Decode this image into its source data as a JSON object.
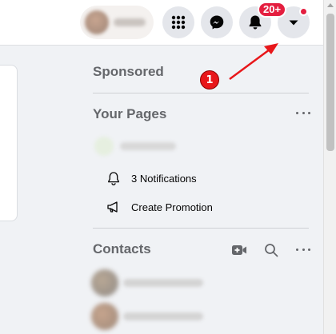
{
  "header": {
    "notification_badge": "20+",
    "icons": [
      "menu-grid-icon",
      "messenger-icon",
      "bell-icon",
      "caret-down-icon"
    ]
  },
  "sidebar": {
    "sponsored_title": "Sponsored",
    "pages": {
      "title": "Your Pages",
      "notifications_label": "3 Notifications",
      "promotion_label": "Create Promotion"
    },
    "contacts": {
      "title": "Contacts"
    }
  },
  "annotation": {
    "step_number": "1",
    "color": "#e8171a"
  },
  "colors": {
    "accent_red": "#e41e3f",
    "section_text": "#65676b",
    "icon_bg": "#e4e6eb"
  }
}
